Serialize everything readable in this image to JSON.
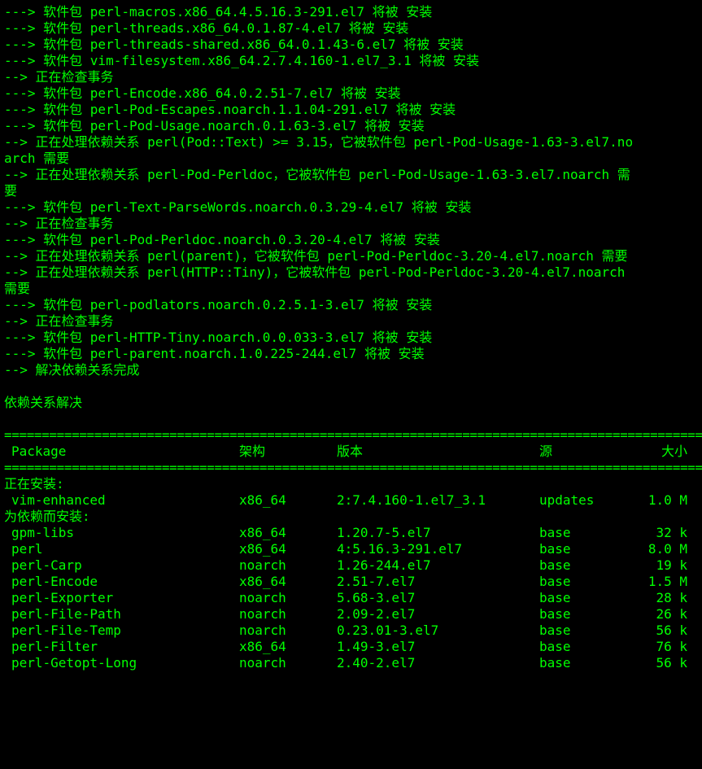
{
  "colors": {
    "background": "#000000",
    "text": "#00ff00"
  },
  "log_lines": [
    "---> 软件包 perl-macros.x86_64.4.5.16.3-291.el7 将被 安装",
    "---> 软件包 perl-threads.x86_64.0.1.87-4.el7 将被 安装",
    "---> 软件包 perl-threads-shared.x86_64.0.1.43-6.el7 将被 安装",
    "---> 软件包 vim-filesystem.x86_64.2.7.4.160-1.el7_3.1 将被 安装",
    "--> 正在检查事务",
    "---> 软件包 perl-Encode.x86_64.0.2.51-7.el7 将被 安装",
    "---> 软件包 perl-Pod-Escapes.noarch.1.1.04-291.el7 将被 安装",
    "---> 软件包 perl-Pod-Usage.noarch.0.1.63-3.el7 将被 安装",
    "--> 正在处理依赖关系 perl(Pod::Text) >= 3.15，它被软件包 perl-Pod-Usage-1.63-3.el7.no",
    "arch 需要",
    "--> 正在处理依赖关系 perl-Pod-Perldoc，它被软件包 perl-Pod-Usage-1.63-3.el7.noarch 需",
    "要",
    "---> 软件包 perl-Text-ParseWords.noarch.0.3.29-4.el7 将被 安装",
    "--> 正在检查事务",
    "---> 软件包 perl-Pod-Perldoc.noarch.0.3.20-4.el7 将被 安装",
    "--> 正在处理依赖关系 perl(parent)，它被软件包 perl-Pod-Perldoc-3.20-4.el7.noarch 需要",
    "--> 正在处理依赖关系 perl(HTTP::Tiny)，它被软件包 perl-Pod-Perldoc-3.20-4.el7.noarch",
    "需要",
    "---> 软件包 perl-podlators.noarch.0.2.5.1-3.el7 将被 安装",
    "--> 正在检查事务",
    "---> 软件包 perl-HTTP-Tiny.noarch.0.0.033-3.el7 将被 安装",
    "---> 软件包 perl-parent.noarch.1.0.225-244.el7 将被 安装",
    "--> 解决依赖关系完成",
    "",
    "依赖关系解决",
    ""
  ],
  "separator": "================================================================================================================================",
  "table": {
    "headers": {
      "package": "Package",
      "arch": "架构",
      "version": "版本",
      "repo": "源",
      "size": "大小"
    },
    "section_installing": "正在安装:",
    "installing": [
      {
        "package": "vim-enhanced",
        "arch": "x86_64",
        "version": "2:7.4.160-1.el7_3.1",
        "repo": "updates",
        "size": "1.0 M"
      }
    ],
    "section_deps": "为依赖而安装:",
    "deps": [
      {
        "package": "gpm-libs",
        "arch": "x86_64",
        "version": "1.20.7-5.el7",
        "repo": "base",
        "size": "32 k"
      },
      {
        "package": "perl",
        "arch": "x86_64",
        "version": "4:5.16.3-291.el7",
        "repo": "base",
        "size": "8.0 M"
      },
      {
        "package": "perl-Carp",
        "arch": "noarch",
        "version": "1.26-244.el7",
        "repo": "base",
        "size": "19 k"
      },
      {
        "package": "perl-Encode",
        "arch": "x86_64",
        "version": "2.51-7.el7",
        "repo": "base",
        "size": "1.5 M"
      },
      {
        "package": "perl-Exporter",
        "arch": "noarch",
        "version": "5.68-3.el7",
        "repo": "base",
        "size": "28 k"
      },
      {
        "package": "perl-File-Path",
        "arch": "noarch",
        "version": "2.09-2.el7",
        "repo": "base",
        "size": "26 k"
      },
      {
        "package": "perl-File-Temp",
        "arch": "noarch",
        "version": "0.23.01-3.el7",
        "repo": "base",
        "size": "56 k"
      },
      {
        "package": "perl-Filter",
        "arch": "x86_64",
        "version": "1.49-3.el7",
        "repo": "base",
        "size": "76 k"
      },
      {
        "package": "perl-Getopt-Long",
        "arch": "noarch",
        "version": "2.40-2.el7",
        "repo": "base",
        "size": "56 k"
      }
    ]
  }
}
